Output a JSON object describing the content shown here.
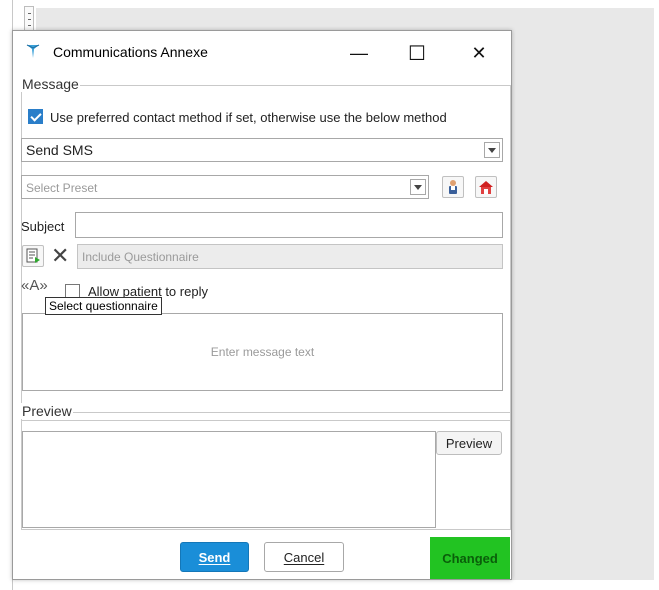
{
  "window": {
    "title": "Communications Annexe",
    "minimize_glyph": "—",
    "maximize_glyph": "☐",
    "close_glyph": "✕"
  },
  "message": {
    "legend": "Message",
    "preferred_contact": {
      "label": "Use preferred contact method if set, otherwise use the below method",
      "checked": true
    },
    "method": {
      "value": "Send SMS"
    },
    "preset": {
      "placeholder": "Select Preset"
    },
    "subject": {
      "label": "Subject",
      "value": ""
    },
    "questionnaire": {
      "placeholder": "Include Questionnaire",
      "remove_glyph": "✕"
    },
    "allow_reply": {
      "label": "Allow patient to reply",
      "checked": false
    },
    "message_text": {
      "placeholder": "Enter message text"
    },
    "tooltip": "Select questionnaire",
    "insert_field_glyph": "«A»"
  },
  "preview": {
    "legend": "Preview",
    "button_label": "Preview"
  },
  "footer": {
    "send_label": "Send",
    "cancel_label": "Cancel",
    "status": "Changed"
  },
  "colors": {
    "accent": "#1a8ed8",
    "checkbox": "#2a7ec9",
    "status_changed": "#22c322"
  }
}
